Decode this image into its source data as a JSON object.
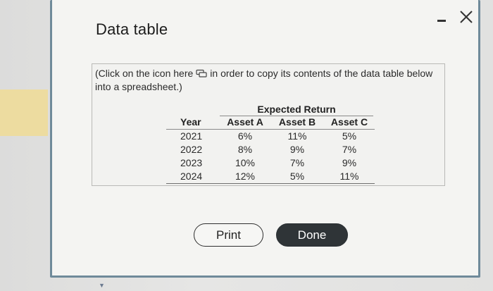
{
  "dialog": {
    "title": "Data table",
    "instruction_before_icon": "(Click on the icon here",
    "instruction_after_icon": "in order to copy its contents of the data table below into a spreadsheet.)"
  },
  "table": {
    "group_header": "Expected Return",
    "columns": [
      "Year",
      "Asset A",
      "Asset B",
      "Asset C"
    ],
    "rows": [
      [
        "2021",
        "6%",
        "11%",
        "5%"
      ],
      [
        "2022",
        "8%",
        "9%",
        "7%"
      ],
      [
        "2023",
        "10%",
        "7%",
        "9%"
      ],
      [
        "2024",
        "12%",
        "5%",
        "11%"
      ]
    ]
  },
  "buttons": {
    "print_label": "Print",
    "done_label": "Done"
  },
  "icons": {
    "minimize": "minimize-icon",
    "close": "close-icon",
    "copy": "copy-icon"
  }
}
